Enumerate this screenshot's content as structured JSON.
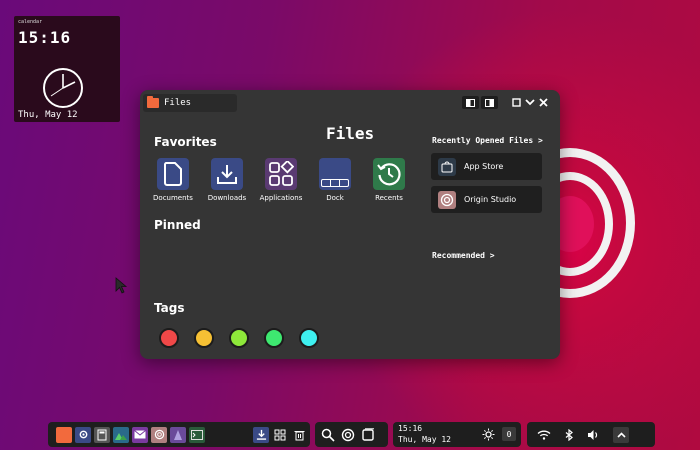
{
  "clock_widget": {
    "calendar_label": "calendar",
    "time": "15:16",
    "date": "Thu, May 12"
  },
  "window": {
    "tab_title": "Files",
    "heading": "Files",
    "favorites_title": "Favorites",
    "favorites": [
      {
        "label": "Documents",
        "icon": "document-icon",
        "color": "#3a4a86"
      },
      {
        "label": "Downloads",
        "icon": "download-icon",
        "color": "#3a4a86"
      },
      {
        "label": "Applications",
        "icon": "apps-icon",
        "color": "#5a3a72"
      },
      {
        "label": "Dock",
        "icon": "dock-icon",
        "color": "#3a4a86"
      },
      {
        "label": "Recents",
        "icon": "history-icon",
        "color": "#2f7a4a"
      }
    ],
    "pinned_title": "Pinned",
    "recent_files_link": "Recently Opened Files >",
    "recent_apps": [
      {
        "label": "App Store",
        "icon": "app-store-icon"
      },
      {
        "label": "Origin Studio",
        "icon": "origin-studio-icon"
      }
    ],
    "recommended_link": "Recommended >",
    "tags_title": "Tags",
    "tags": [
      "#f04848",
      "#f6c034",
      "#8ee83a",
      "#3ee870",
      "#3ef0f0"
    ]
  },
  "taskbar": {
    "apps": [
      "files-icon",
      "settings-icon",
      "calculator-icon",
      "photos-icon",
      "mail-icon",
      "origin-icon",
      "editor-icon",
      "terminal-icon"
    ],
    "time": "15:16",
    "date": "Thu, May 12",
    "notification_count": "0"
  }
}
